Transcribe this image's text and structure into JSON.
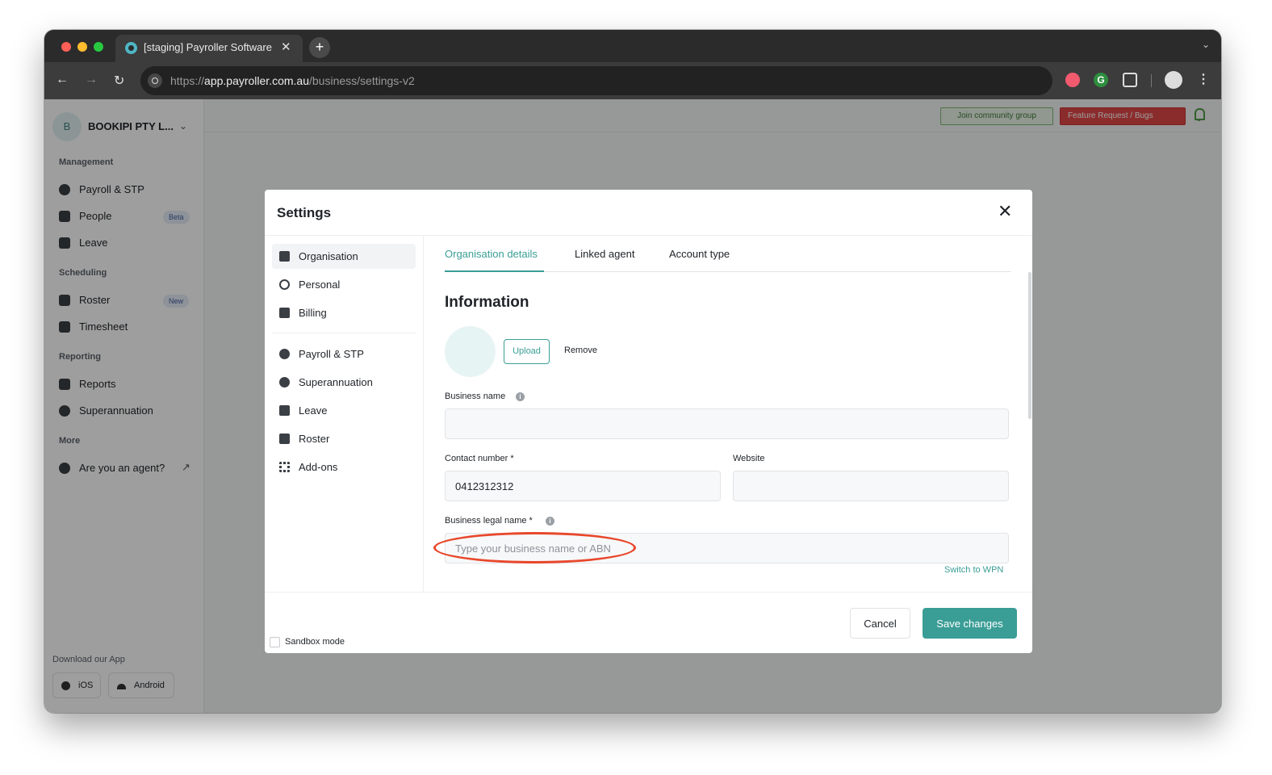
{
  "browser": {
    "tab_title": "[staging] Payroller Software W",
    "url_scheme": "https://",
    "url_host": "app.payroller.com.au",
    "url_path": "/business/settings-v2",
    "extension_g": "G"
  },
  "sidebar": {
    "business_avatar": "B",
    "business_name": "BOOKIPI PTY L...",
    "sections": {
      "management": "Management",
      "scheduling": "Scheduling",
      "reporting": "Reporting",
      "more": "More"
    },
    "items": [
      {
        "label": "Payroll & STP",
        "icon": "payroll-icon"
      },
      {
        "label": "People",
        "icon": "people-icon",
        "badge": "Beta"
      },
      {
        "label": "Leave",
        "icon": "leave-icon"
      },
      {
        "label": "Roster",
        "icon": "calendar-icon",
        "badge": "New"
      },
      {
        "label": "Timesheet",
        "icon": "timesheet-icon"
      },
      {
        "label": "Reports",
        "icon": "reports-icon"
      },
      {
        "label": "Superannuation",
        "icon": "piggy-bank-icon"
      },
      {
        "label": "Are you an agent?",
        "icon": "question-icon"
      }
    ],
    "download_label": "Download our App",
    "ios_label": "iOS",
    "android_label": "Android"
  },
  "topbar": {
    "join_label": "Join community group",
    "feature_label": "Feature Request / Bugs"
  },
  "modal": {
    "title": "Settings",
    "nav": [
      {
        "label": "Organisation",
        "icon": "organisation-icon"
      },
      {
        "label": "Personal",
        "icon": "user-circle-icon"
      },
      {
        "label": "Billing",
        "icon": "credit-card-icon"
      },
      {
        "label": "Payroll & STP",
        "icon": "payroll-icon"
      },
      {
        "label": "Superannuation",
        "icon": "piggy-bank-icon"
      },
      {
        "label": "Leave",
        "icon": "leave-icon"
      },
      {
        "label": "Roster",
        "icon": "calendar-icon"
      },
      {
        "label": "Add-ons",
        "icon": "add-ons-icon"
      }
    ],
    "tabs": [
      "Organisation details",
      "Linked agent",
      "Account type"
    ],
    "section_title": "Information",
    "upload_label": "Upload",
    "remove_label": "Remove",
    "fields": {
      "business_name_label": "Business name",
      "business_name_value": "",
      "contact_label": "Contact number *",
      "contact_value": "0412312312",
      "website_label": "Website",
      "website_value": "",
      "legal_name_label": "Business legal name *",
      "legal_name_placeholder": "Type your business name or ABN"
    },
    "switch_link": "Switch to WPN",
    "cancel_label": "Cancel",
    "save_label": "Save changes",
    "sandbox_label": "Sandbox mode"
  },
  "accent_color": "#3a9d96",
  "annotation_color": "#e8472b"
}
